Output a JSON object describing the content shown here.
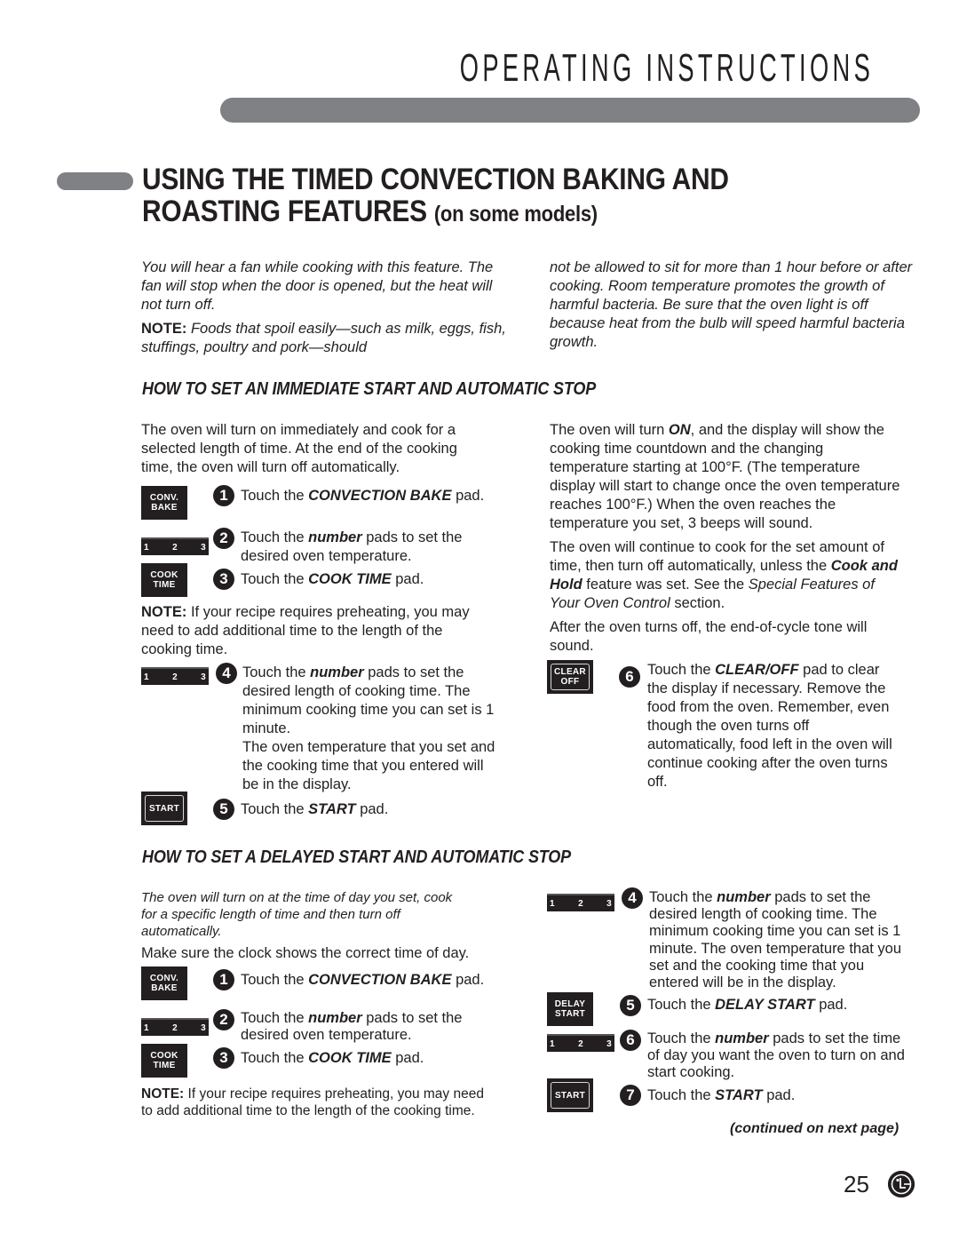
{
  "header": {
    "title": "OPERATING INSTRUCTIONS"
  },
  "section": {
    "title_line1": "USING THE TIMED CONVECTION BAKING AND",
    "title_line2": "ROASTING FEATURES",
    "title_suffix": "(on some models)"
  },
  "intro": {
    "left_para": "You will hear a fan while cooking with this feature. The fan will stop when the door is opened, but the heat will not turn off.",
    "note_label": "NOTE:",
    "note_text": "Foods that spoil easily—such as milk, eggs, fish, stuffings, poultry and pork—should",
    "right_para": "not be allowed to sit for more than 1 hour before or after cooking. Room temperature promotes the growth of harmful bacteria. Be sure that the oven light is off because heat from the bulb will speed harmful bacteria growth."
  },
  "immediate": {
    "heading": "HOW TO SET AN IMMEDIATE START AND AUTOMATIC STOP",
    "intro": "The oven will turn on immediately and cook for a selected length of time. At the end of the cooking time, the oven will turn off automatically.",
    "note_label": "NOTE:",
    "note_text": "If your recipe requires preheating, you may need to add additional time to the length of the cooking time.",
    "steps": [
      {
        "num": "1",
        "pre": "Touch the ",
        "em": "CONVECTION BAKE",
        "post": " pad."
      },
      {
        "num": "2",
        "pre": "Touch the ",
        "em": "number",
        "post": " pads to set the desired oven temperature."
      },
      {
        "num": "3",
        "pre": "Touch the ",
        "em": "COOK TIME",
        "post": " pad."
      },
      {
        "num": "4",
        "pre": "Touch the ",
        "em": "number",
        "post": " pads to set the desired length of cooking time. The minimum cooking time you can set is 1 minute.",
        "extra": "The oven temperature that you set and the cooking time that you entered will be in the display."
      },
      {
        "num": "5",
        "pre": "Touch the ",
        "em": "START",
        "post": " pad."
      },
      {
        "num": "6",
        "pre": "Touch the ",
        "em": "CLEAR/OFF",
        "post": " pad to clear the display if necessary. Remove the food from the oven. Remember, even though the oven turns off automatically, food left in the oven will continue cooking after the oven turns off."
      }
    ],
    "right_p1_a": "The oven will turn ",
    "right_p1_em": "ON",
    "right_p1_b": ", and the display will show the cooking time countdown and the changing temperature starting at 100°F. (The temperature display will start to change once the oven temperature reaches 100°F.) When the oven reaches the temperature you set, 3 beeps will sound.",
    "right_p2_a": "The oven will continue to cook for the set amount of time, then turn off automatically, unless the ",
    "right_p2_em": "Cook and Hold",
    "right_p2_b": " feature was set. See the ",
    "right_p2_it": "Special Features of Your Oven Control",
    "right_p2_c": " section.",
    "right_p3": "After the oven turns off, the end-of-cycle tone will sound."
  },
  "delayed": {
    "heading": "HOW TO SET A DELAYED START AND AUTOMATIC STOP",
    "intro_italic": "The oven will turn on at the time of day you set, cook for a specific length of time and then turn off automatically.",
    "clock_note": "Make sure the clock shows the correct time of day.",
    "note_label": "NOTE:",
    "note_text": "If your recipe requires preheating, you may need to add additional time to the length of the cooking time.",
    "steps": [
      {
        "num": "1",
        "pre": "Touch the ",
        "em": "CONVECTION BAKE",
        "post": " pad."
      },
      {
        "num": "2",
        "pre": "Touch the ",
        "em": "number",
        "post": " pads to set the desired oven temperature."
      },
      {
        "num": "3",
        "pre": "Touch the ",
        "em": "COOK TIME",
        "post": " pad."
      },
      {
        "num": "4",
        "pre": "Touch the ",
        "em": "number",
        "post": " pads to set the desired length of cooking time. The minimum cooking time you can set is 1 minute. The oven temperature that you set and the cooking time that you entered will be in the display."
      },
      {
        "num": "5",
        "pre": "Touch the ",
        "em": "DELAY START",
        "post": " pad."
      },
      {
        "num": "6",
        "pre": "Touch the ",
        "em": "number",
        "post": " pads to set the time of day you want the oven to turn on and start cooking."
      },
      {
        "num": "7",
        "pre": "Touch the ",
        "em": "START",
        "post": " pad."
      }
    ],
    "continued": "(continued on next page)"
  },
  "pads": {
    "conv_bake_1": "CONV.",
    "conv_bake_2": "BAKE",
    "cook_time_1": "COOK",
    "cook_time_2": "TIME",
    "start": "START",
    "clear_1": "CLEAR",
    "clear_2": "OFF",
    "delay_1": "DELAY",
    "delay_2": "START",
    "num_1": "1",
    "num_2": "2",
    "num_3": "3"
  },
  "footer": {
    "page_number": "25",
    "logo": "lg-logo"
  }
}
